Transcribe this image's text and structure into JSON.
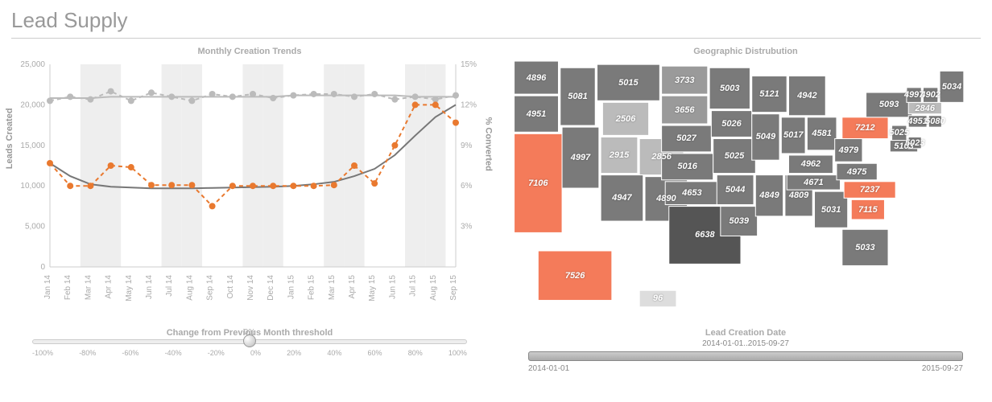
{
  "page_title": "Lead Supply",
  "chart_panel_title": "Monthly Creation Trends",
  "map_panel_title": "Geographic Distrubution",
  "y_axis_label": "Leads Created",
  "y2_axis_label": "% Converted",
  "y_ticks": [
    "0",
    "5,000",
    "10,000",
    "15,000",
    "20,000",
    "25,000"
  ],
  "y2_ticks": [
    "3%",
    "6%",
    "9%",
    "12%",
    "15%"
  ],
  "x_labels": [
    "Jan 14",
    "Feb 14",
    "Mar 14",
    "Apr 14",
    "May 14",
    "Jun 14",
    "Jul 14",
    "Aug 14",
    "Sep 14",
    "Oct 14",
    "Nov 14",
    "Dec 14",
    "Jan 15",
    "Feb 15",
    "Mar 15",
    "Apr 15",
    "May 15",
    "Jun 15",
    "Jul 15",
    "Aug 15",
    "Sep 15"
  ],
  "threshold_title": "Change from Previous Month threshold",
  "threshold_center": "0%",
  "threshold_ticks": [
    "-100%",
    "-80%",
    "-60%",
    "-40%",
    "-20%",
    "0%",
    "20%",
    "40%",
    "60%",
    "80%",
    "100%"
  ],
  "date_slider_title": "Lead Creation Date",
  "date_range_text": "2014-01-01..2015-09-27",
  "date_start": "2014-01-01",
  "date_end": "2015-09-27",
  "chart_data": [
    {
      "type": "line",
      "title": "Monthly Creation Trends",
      "xlabel": "",
      "ylabel": "Leads Created",
      "y2label": "% Converted",
      "categories": [
        "Jan 14",
        "Feb 14",
        "Mar 14",
        "Apr 14",
        "May 14",
        "Jun 14",
        "Jul 14",
        "Aug 14",
        "Sep 14",
        "Oct 14",
        "Nov 14",
        "Dec 14",
        "Jan 15",
        "Feb 15",
        "Mar 15",
        "Apr 15",
        "May 15",
        "Jun 15",
        "Jul 15",
        "Aug 15",
        "Sep 15"
      ],
      "ylim": [
        0,
        25000
      ],
      "y2lim": [
        0,
        15
      ],
      "series": [
        {
          "name": "Leads Created (actual)",
          "axis": "y",
          "color": "#e9792f",
          "values": [
            12800,
            10000,
            10000,
            12500,
            12300,
            10100,
            10100,
            10100,
            7500,
            10000,
            10000,
            10000,
            10000,
            10000,
            10100,
            12500,
            10300,
            15000,
            20000,
            20000,
            17800
          ]
        },
        {
          "name": "Leads Created (trend)",
          "axis": "y",
          "color": "#777",
          "values": [
            12800,
            11200,
            10200,
            9900,
            9800,
            9700,
            9700,
            9700,
            9750,
            9800,
            9850,
            9900,
            10000,
            10200,
            10500,
            11200,
            12100,
            13800,
            16200,
            18500,
            20000
          ]
        },
        {
          "name": "% Converted (actual)",
          "axis": "y2",
          "color": "#bbb",
          "values": [
            12.3,
            12.6,
            12.4,
            13.0,
            12.3,
            12.9,
            12.6,
            12.3,
            12.8,
            12.6,
            12.8,
            12.5,
            12.7,
            12.8,
            12.8,
            12.6,
            12.8,
            12.4,
            12.6,
            12.4,
            12.7
          ]
        },
        {
          "name": "% Converted (trend)",
          "axis": "y2",
          "color": "#bbb",
          "values": [
            12.5,
            12.5,
            12.5,
            12.6,
            12.6,
            12.6,
            12.6,
            12.6,
            12.6,
            12.6,
            12.6,
            12.6,
            12.7,
            12.7,
            12.7,
            12.7,
            12.7,
            12.7,
            12.6,
            12.6,
            12.6
          ]
        }
      ]
    },
    {
      "type": "map",
      "title": "Geographic Distrubution",
      "data": [
        {
          "state": "WA",
          "value": 4896,
          "highlight": false
        },
        {
          "state": "OR",
          "value": 4951,
          "highlight": false
        },
        {
          "state": "CA",
          "value": 7106,
          "highlight": true
        },
        {
          "state": "NV",
          "value": 4997,
          "highlight": false
        },
        {
          "state": "ID",
          "value": 5081,
          "highlight": false
        },
        {
          "state": "MT",
          "value": 5015,
          "highlight": false
        },
        {
          "state": "WY",
          "value": 2506,
          "highlight": false
        },
        {
          "state": "UT",
          "value": 2915,
          "highlight": false
        },
        {
          "state": "CO",
          "value": 2856,
          "highlight": false
        },
        {
          "state": "AZ",
          "value": 4947,
          "highlight": false
        },
        {
          "state": "NM",
          "value": 4890,
          "highlight": false
        },
        {
          "state": "ND",
          "value": 3733,
          "highlight": false
        },
        {
          "state": "SD",
          "value": 3656,
          "highlight": false
        },
        {
          "state": "NE",
          "value": 5027,
          "highlight": false
        },
        {
          "state": "KS",
          "value": 5016,
          "highlight": false
        },
        {
          "state": "OK",
          "value": 4653,
          "highlight": false
        },
        {
          "state": "TX",
          "value": 6638,
          "highlight": false
        },
        {
          "state": "MN",
          "value": 5003,
          "highlight": false
        },
        {
          "state": "IA",
          "value": 5026,
          "highlight": false
        },
        {
          "state": "MO",
          "value": 5025,
          "highlight": false
        },
        {
          "state": "AR",
          "value": 5044,
          "highlight": false
        },
        {
          "state": "LA",
          "value": 5039,
          "highlight": false
        },
        {
          "state": "WI",
          "value": 5121,
          "highlight": false
        },
        {
          "state": "IL",
          "value": 5049,
          "highlight": false
        },
        {
          "state": "MS",
          "value": 4849,
          "highlight": false
        },
        {
          "state": "AL",
          "value": 4809,
          "highlight": false
        },
        {
          "state": "MI",
          "value": 4942,
          "highlight": false
        },
        {
          "state": "IN",
          "value": 5017,
          "highlight": false
        },
        {
          "state": "OH",
          "value": 4581,
          "highlight": false
        },
        {
          "state": "KY",
          "value": 4962,
          "highlight": false
        },
        {
          "state": "TN",
          "value": 4671,
          "highlight": false
        },
        {
          "state": "GA",
          "value": 5031,
          "highlight": false
        },
        {
          "state": "FL",
          "value": 5033,
          "highlight": false
        },
        {
          "state": "WV",
          "value": 4979,
          "highlight": false
        },
        {
          "state": "VA",
          "value": 4975,
          "highlight": false
        },
        {
          "state": "NC",
          "value": 7237,
          "highlight": true
        },
        {
          "state": "SC",
          "value": 7115,
          "highlight": true
        },
        {
          "state": "PA",
          "value": 7212,
          "highlight": true
        },
        {
          "state": "NY",
          "value": 5093,
          "highlight": false
        },
        {
          "state": "MD",
          "value": 5103,
          "highlight": false
        },
        {
          "state": "NJ",
          "value": 5025,
          "highlight": false
        },
        {
          "state": "DE",
          "value": 5023,
          "highlight": false
        },
        {
          "state": "CT",
          "value": 4951,
          "highlight": false
        },
        {
          "state": "RI",
          "value": 5080,
          "highlight": false
        },
        {
          "state": "MA",
          "value": 2846,
          "highlight": false
        },
        {
          "state": "NH",
          "value": 4902,
          "highlight": false
        },
        {
          "state": "VT",
          "value": 4997,
          "highlight": false
        },
        {
          "state": "ME",
          "value": 5034,
          "highlight": false
        },
        {
          "state": "AK",
          "value": 7526,
          "highlight": true
        },
        {
          "state": "HI",
          "value": 96,
          "highlight": false
        }
      ]
    }
  ]
}
